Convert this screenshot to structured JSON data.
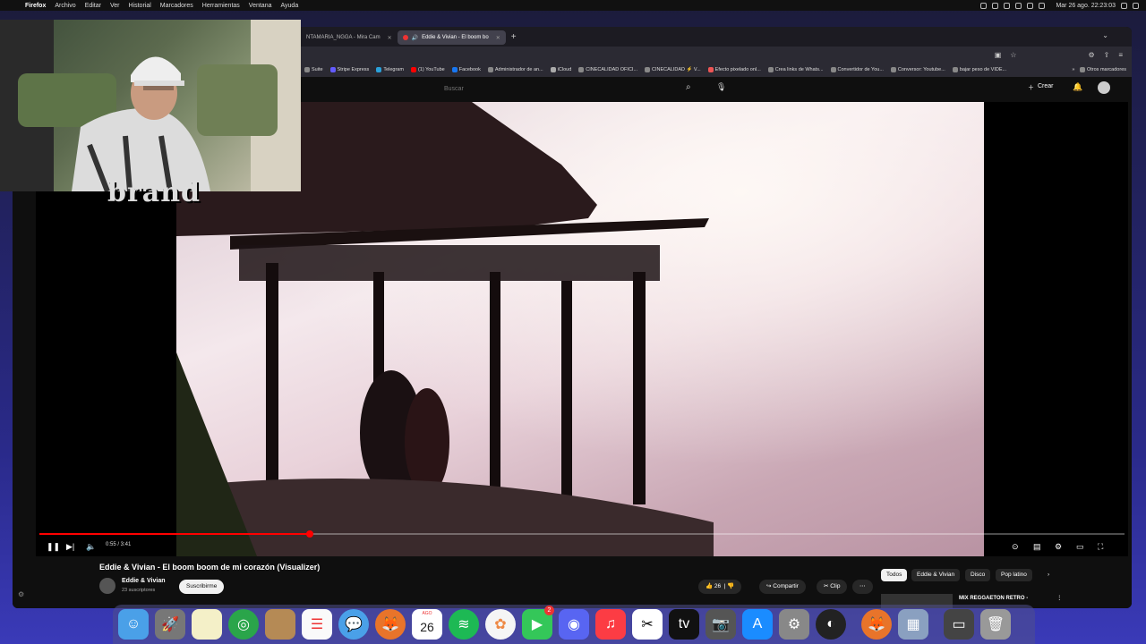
{
  "menubar": {
    "app": "Firefox",
    "menus": [
      "Archivo",
      "Editar",
      "Ver",
      "Historial",
      "Marcadores",
      "Herramientas",
      "Ventana",
      "Ayuda"
    ],
    "clock": "Mar 26 ago.  22:23:03"
  },
  "browser": {
    "tabs": [
      {
        "label": "NTAMARIA_NGGA - Mira Cam"
      },
      {
        "label": "Eddie & Vivian - El boom bo"
      }
    ],
    "new_tab": "+",
    "bookmarks": [
      "Suite",
      "Stripe Express",
      "Telegram",
      "(1) YouTube",
      "Facebook",
      "Administrador de an...",
      "iCloud",
      "CINECALIDAD OFICI...",
      "CINECALIDAD ⚡ V...",
      "Efecto pixelado onl...",
      "Crea links de Whats...",
      "Convertidor de You...",
      "Conversor: Youtube...",
      "bajar peso de VIDE..."
    ],
    "other_bookmarks": "Otros marcadores"
  },
  "youtube": {
    "search_placeholder": "Buscar",
    "create_label": "Crear",
    "player": {
      "time": "0:55 / 3:41",
      "progress_fraction": 0.249
    },
    "video_title": "Eddie & Vivian - El boom boom de mi corazón (Visualizer)",
    "channel_name": "Eddie & Vivian",
    "subscribers": "23 suscriptores",
    "subscribe_label": "Suscribirme",
    "likes": "26",
    "share_label": "Compartir",
    "clip_label": "Clip",
    "chips": [
      "Todos",
      "Eddie & Vivian",
      "Disco",
      "Pop latino"
    ],
    "recommendation_title": "MIX REGGAETON RETRO -"
  },
  "overlay": {
    "brand_text": "brand"
  },
  "dock": {
    "calendar_month": "AGO",
    "calendar_day": "26",
    "facetime_badge": "2"
  },
  "colors": {
    "accent": "#ff0000",
    "youtube_bg": "#0f0f0f"
  }
}
